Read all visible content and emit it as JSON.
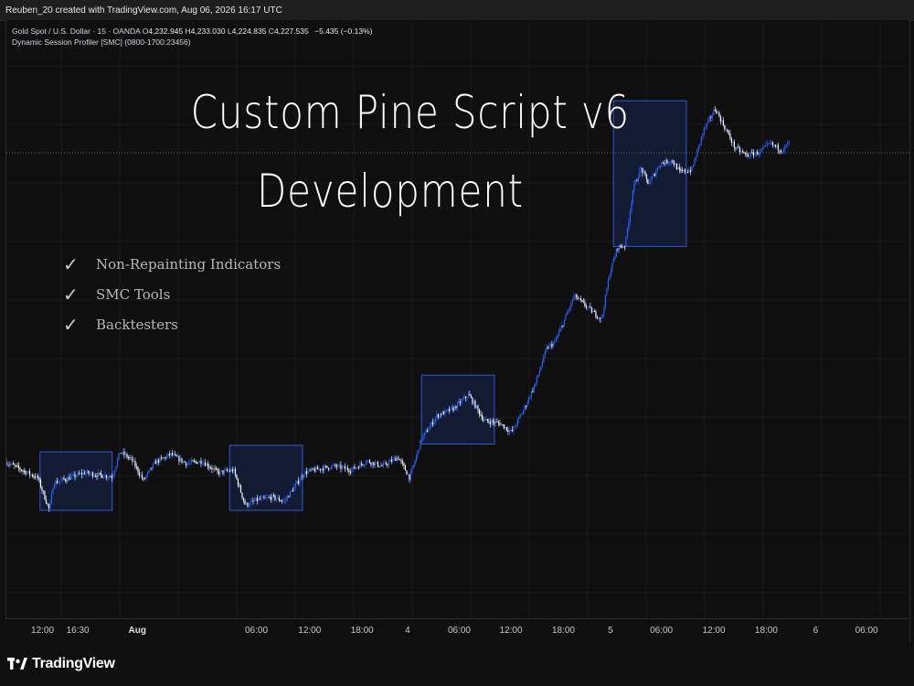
{
  "header": {
    "credit": "Reuben_20 created with TradingView.com, Aug 06, 2026 16:17 UTC"
  },
  "legend": {
    "symbol": "Gold Spot / U.S. Dollar · 15 · OANDA",
    "o_label": "O",
    "o": "4,232.945",
    "h_label": "H",
    "h": "4,233.030",
    "l_label": "L",
    "l": "4,224.835",
    "c_label": "C",
    "c": "4,227.535",
    "change": "−5.435 (−0.13%)",
    "indicator": "Dynamic Session Profiler [SMC] (0800-1700:23456)"
  },
  "headline": {
    "line1": "Custom Pine Script v6",
    "line2": "Development"
  },
  "features": [
    {
      "check": "✓",
      "label": "Non-Repainting Indicators"
    },
    {
      "check": "✓",
      "label": "SMC Tools"
    },
    {
      "check": "✓",
      "label": "Backtesters"
    }
  ],
  "footer": {
    "brand": "TradingView"
  },
  "colors": {
    "background": "#0f0f0f",
    "candle_up": "#2962ff",
    "candle_down": "#ffffff",
    "session_box_border": "#2f5bd6",
    "session_box_fill": "#15203f"
  },
  "chart_data": {
    "type": "candlestick",
    "symbol": "XAUUSD",
    "timeframe": "15",
    "x_ticks": [
      {
        "label": "12:00",
        "t": 0.115
      },
      {
        "label": "16:30",
        "t": 0.16
      },
      {
        "label": "Aug",
        "t": 0.236,
        "bold": true
      },
      {
        "label": "06:00",
        "t": 0.388
      },
      {
        "label": "12:00",
        "t": 0.456
      },
      {
        "label": "18:00",
        "t": 0.523
      },
      {
        "label": "4",
        "t": 0.581
      },
      {
        "label": "06:00",
        "t": 0.647
      },
      {
        "label": "12:00",
        "t": 0.713
      },
      {
        "label": "18:00",
        "t": 0.78
      },
      {
        "label": "5",
        "t": 0.84
      },
      {
        "label": "06:00",
        "t": 0.905
      },
      {
        "label": "12:00",
        "t": 0.972
      },
      {
        "label": "18:00",
        "t": 1.039
      },
      {
        "label": "6",
        "t": 1.102
      },
      {
        "label": "06:00",
        "t": 1.167
      }
    ],
    "price_path": [
      [
        0.0,
        4040
      ],
      [
        0.02,
        4034
      ],
      [
        0.04,
        4028
      ],
      [
        0.055,
        4003
      ],
      [
        0.06,
        4024
      ],
      [
        0.08,
        4028
      ],
      [
        0.1,
        4032
      ],
      [
        0.12,
        4030
      ],
      [
        0.135,
        4029
      ],
      [
        0.145,
        4048
      ],
      [
        0.16,
        4042
      ],
      [
        0.175,
        4026
      ],
      [
        0.19,
        4040
      ],
      [
        0.21,
        4046
      ],
      [
        0.23,
        4039
      ],
      [
        0.25,
        4041
      ],
      [
        0.27,
        4032
      ],
      [
        0.29,
        4034
      ],
      [
        0.305,
        4007
      ],
      [
        0.32,
        4011
      ],
      [
        0.34,
        4013
      ],
      [
        0.355,
        4010
      ],
      [
        0.37,
        4023
      ],
      [
        0.38,
        4032
      ],
      [
        0.4,
        4035
      ],
      [
        0.42,
        4037
      ],
      [
        0.44,
        4034
      ],
      [
        0.46,
        4041
      ],
      [
        0.48,
        4037
      ],
      [
        0.5,
        4044
      ],
      [
        0.515,
        4028
      ],
      [
        0.53,
        4058
      ],
      [
        0.55,
        4076
      ],
      [
        0.57,
        4081
      ],
      [
        0.59,
        4092
      ],
      [
        0.61,
        4072
      ],
      [
        0.63,
        4070
      ],
      [
        0.645,
        4063
      ],
      [
        0.66,
        4080
      ],
      [
        0.675,
        4100
      ],
      [
        0.69,
        4128
      ],
      [
        0.7,
        4132
      ],
      [
        0.71,
        4146
      ],
      [
        0.725,
        4168
      ],
      [
        0.74,
        4160
      ],
      [
        0.76,
        4150
      ],
      [
        0.77,
        4185
      ],
      [
        0.78,
        4205
      ],
      [
        0.79,
        4207
      ],
      [
        0.8,
        4250
      ],
      [
        0.81,
        4266
      ],
      [
        0.82,
        4254
      ],
      [
        0.835,
        4270
      ],
      [
        0.85,
        4272
      ],
      [
        0.86,
        4263
      ],
      [
        0.875,
        4265
      ],
      [
        0.89,
        4295
      ],
      [
        0.905,
        4312
      ],
      [
        0.915,
        4300
      ],
      [
        0.93,
        4282
      ],
      [
        0.945,
        4276
      ],
      [
        0.96,
        4278
      ],
      [
        0.975,
        4285
      ],
      [
        0.99,
        4280
      ],
      [
        1.0,
        4286
      ]
    ],
    "session_boxes": [
      {
        "start": 0.043,
        "end": 0.135,
        "low": 4003,
        "high": 4048
      },
      {
        "start": 0.285,
        "end": 0.378,
        "low": 4003,
        "high": 4053
      },
      {
        "start": 0.53,
        "end": 0.623,
        "low": 4054,
        "high": 4107
      },
      {
        "start": 0.775,
        "end": 0.868,
        "low": 4206,
        "high": 4318
      }
    ],
    "reference_line": {
      "price": 4278,
      "style": "dotted"
    },
    "y_range": [
      3920,
      4380
    ],
    "grid": true
  }
}
